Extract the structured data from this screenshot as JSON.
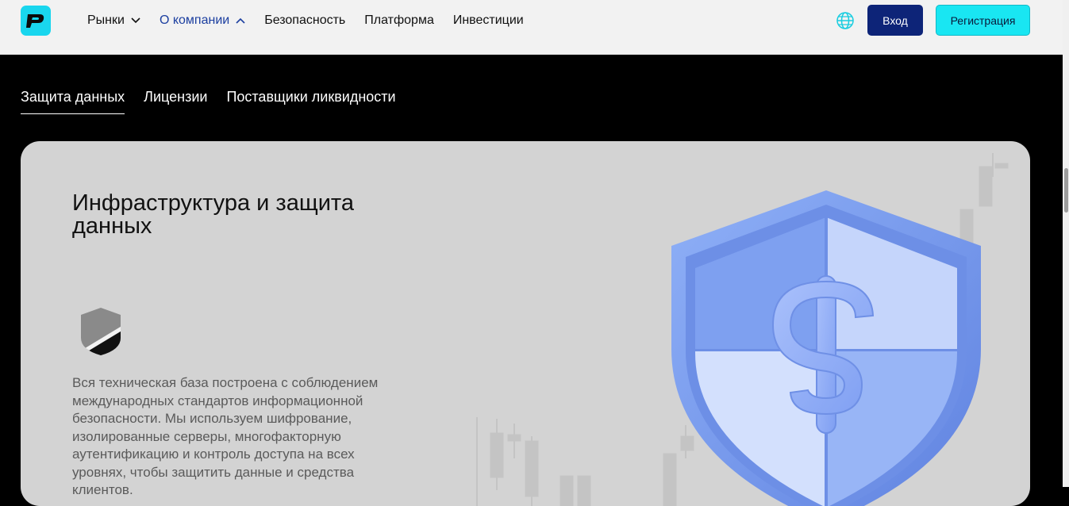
{
  "header": {
    "logo_name": "brand-logo",
    "nav": [
      {
        "label": "Рынки",
        "has_dropdown": true,
        "active": false
      },
      {
        "label": "О компании",
        "has_dropdown": true,
        "active": true
      },
      {
        "label": "Безопасность",
        "has_dropdown": false,
        "active": false
      },
      {
        "label": "Платформа",
        "has_dropdown": false,
        "active": false
      },
      {
        "label": "Инвестиции",
        "has_dropdown": false,
        "active": false
      }
    ],
    "globe_icon": "globe-icon",
    "login_label": "Вход",
    "register_label": "Регистрация"
  },
  "tabs": [
    {
      "label": "Защита данных",
      "active": true
    },
    {
      "label": "Лицензии",
      "active": false
    },
    {
      "label": "Поставщики ликвидности",
      "active": false
    }
  ],
  "section": {
    "title": "Инфраструктура и защита данных",
    "icon": "shield-icon",
    "text": "Вся техническая база построена с соблюдением международных стандартов информационной безопасности. Мы используем шифрование, изолированные серверы, многофакторную аутентификацию и контроль доступа на всех уровнях, чтобы защитить данные и средства клиентов.",
    "illustration": "shield-dollar-illustration"
  },
  "colors": {
    "accent_cyan": "#19e6f2",
    "login_bg": "#0d2478",
    "active_nav": "#1c3fa0",
    "card_bg": "#d3d3d3",
    "shield_blue": "#7d9ff0"
  }
}
